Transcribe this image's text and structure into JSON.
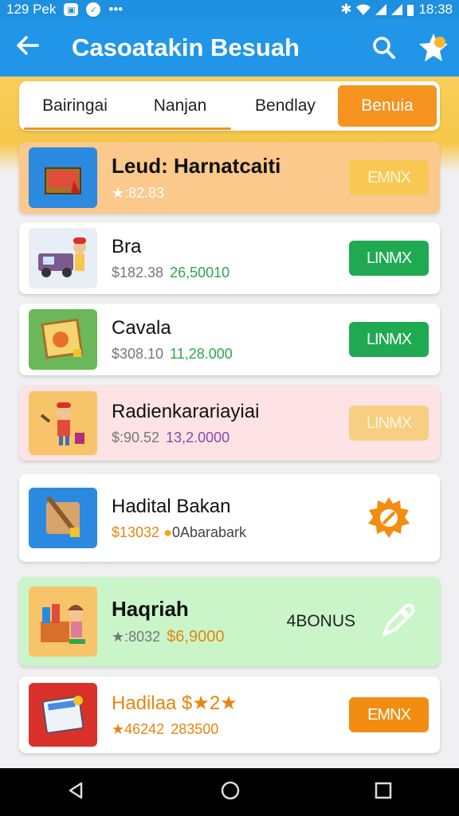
{
  "status_bar": {
    "time_left": "129 Pek",
    "time_right": "18:38",
    "dots": "•••"
  },
  "app_bar": {
    "title": "Casoatakin Besuah"
  },
  "tabs": [
    {
      "label": "Bairingai",
      "active": false
    },
    {
      "label": "Nanjan",
      "active": false
    },
    {
      "label": "Bendlay",
      "active": false
    },
    {
      "label": "Benuia",
      "active": true
    }
  ],
  "items": [
    {
      "name": "Leud: Harnatcaiti",
      "price": "★:82.83",
      "amount": "",
      "button": "EMNX",
      "button_style": "faded",
      "bg": "#fbc98c"
    },
    {
      "name": "Bra",
      "price": "$182.38",
      "amount": "26,50010",
      "button": "LINMX",
      "button_style": "green",
      "bg": "#ffffff"
    },
    {
      "name": "Cavala",
      "price": "$308.10",
      "amount": "11,28.000",
      "button": "LINMX",
      "button_style": "green",
      "bg": "#ffffff"
    },
    {
      "name": "Radienkarariayiai",
      "price": "$:90.52",
      "amount": "13,2.0000",
      "button": "LINMX",
      "button_style": "faded-pink",
      "bg": "#fde3e3"
    },
    {
      "name": "Hadital Bakan",
      "price": "$13032",
      "amount": "0Abarabark",
      "button": "",
      "button_style": "gear",
      "bg": "#ffffff"
    },
    {
      "name": "Haqriah",
      "price": "★:8032",
      "amount": "$6,9000",
      "button": "4BONUS",
      "button_style": "bonus",
      "bg": "#c9f5c9"
    },
    {
      "name": "Hadilaa $★2★",
      "price": "★46242",
      "amount": "283500",
      "button": "EMNX",
      "button_style": "orange",
      "bg": "#ffffff"
    }
  ],
  "colors": {
    "primary": "#2196e8",
    "accent": "#f6931e",
    "green": "#1faa52"
  }
}
